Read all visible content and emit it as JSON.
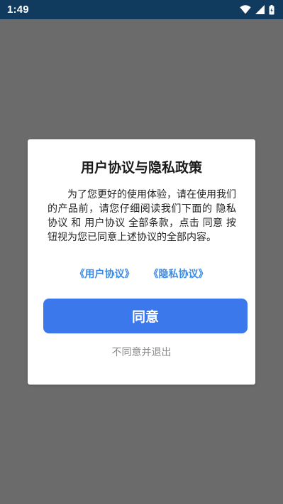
{
  "status_bar": {
    "time": "1:49",
    "icons": [
      "wifi-icon",
      "signal-icon",
      "battery-icon"
    ]
  },
  "dialog": {
    "title": "用户协议与隐私政策",
    "body": "为了您更好的使用体验，请在使用我们的产品前，请您仔细阅读我们下面的 隐私协议 和 用户协议 全部条款，点击 同意 按钮视为您已同意上述协议的全部内容。",
    "links": {
      "user_agreement": "《用户协议》",
      "privacy_agreement": "《隐私协议》"
    },
    "agree_label": "同意",
    "disagree_label": "不同意并退出"
  },
  "colors": {
    "status_bar_bg": "#103a5e",
    "scrim": "#6b6b6b",
    "link": "#3d8ae0",
    "primary_button": "#3a78ec",
    "secondary_text": "#8a8a8a"
  }
}
